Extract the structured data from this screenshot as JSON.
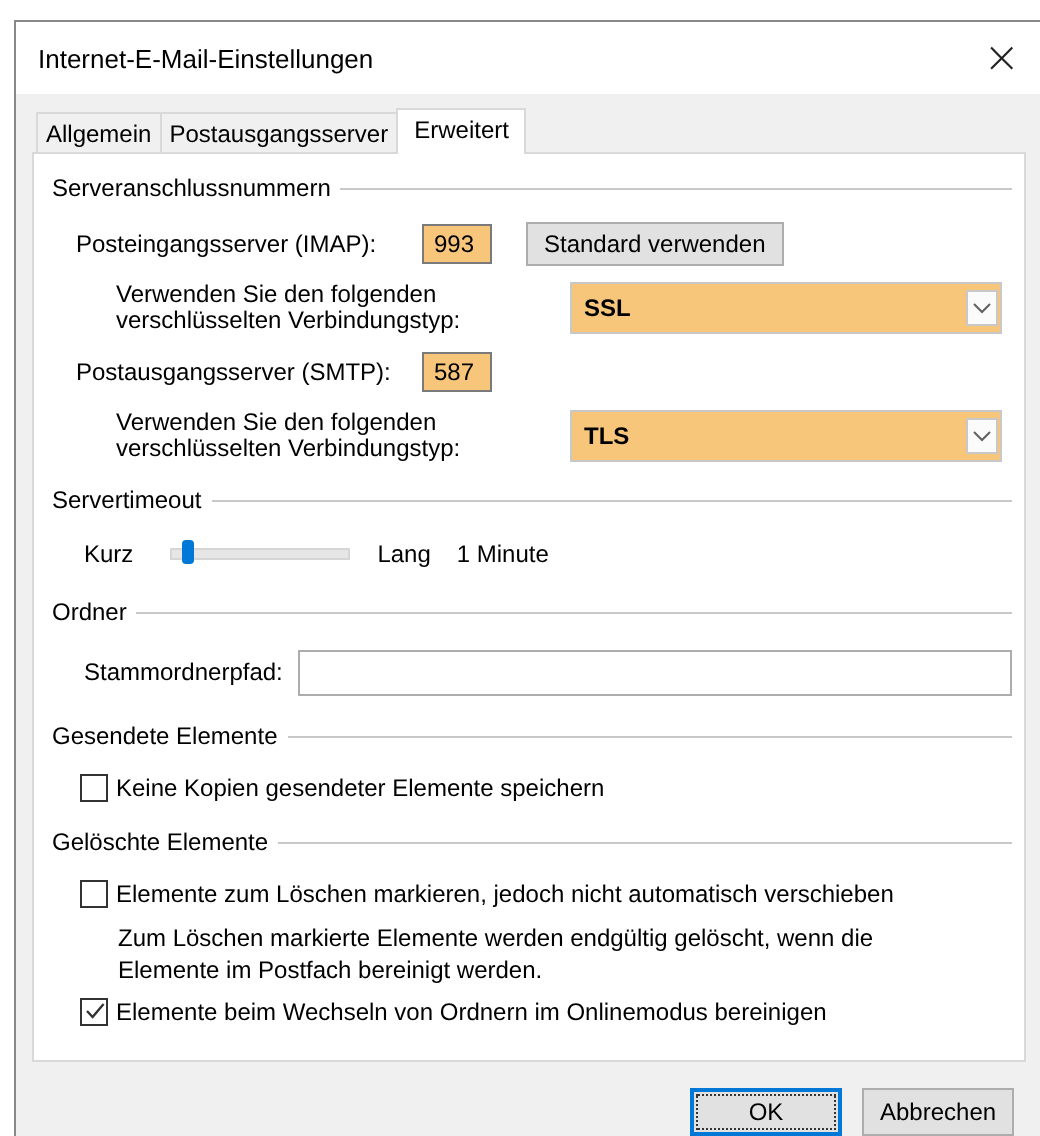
{
  "window": {
    "title": "Internet-E-Mail-Einstellungen",
    "close": "×"
  },
  "tabs": [
    {
      "label": "Allgemein",
      "selected": false
    },
    {
      "label": "Postausgangsserver",
      "selected": false
    },
    {
      "label": "Erweitert",
      "selected": true
    }
  ],
  "sections": [
    {
      "title": "Serveranschlussnummern",
      "items": [
        {
          "kind": "port",
          "label": "Posteingangsserver (IMAP):",
          "value": "993",
          "button": "Standard verwenden"
        },
        {
          "kind": "select",
          "label": "Verwenden Sie den folgenden verschlüsselten Verbindungstyp:",
          "value": "SSL"
        },
        {
          "kind": "port",
          "label": "Postausgangsserver (SMTP):",
          "value": "587"
        },
        {
          "kind": "select",
          "label": "Verwenden Sie den folgenden verschlüsselten Verbindungstyp:",
          "value": "TLS"
        }
      ]
    },
    {
      "title": "Servertimeout",
      "items": [
        {
          "kind": "slider",
          "min_label": "Kurz",
          "max_label": "Lang",
          "reading": "1 Minute",
          "level": 0.1
        }
      ]
    },
    {
      "title": "Ordner",
      "items": [
        {
          "kind": "path",
          "label": "Stammordnerpfad:"
        }
      ]
    },
    {
      "title": "Gesendete Elemente",
      "items": [
        {
          "kind": "checkbox",
          "label": "Keine Kopien gesendeter Elemente speichern",
          "checked": false
        }
      ]
    },
    {
      "title": "Gelöschte Elemente",
      "items": [
        {
          "kind": "checkbox",
          "label": "Elemente zum Löschen markieren, jedoch nicht automatisch verschieben",
          "checked": false
        },
        {
          "kind": "note",
          "text": "Zum Löschen markierte Elemente werden endgültig gelöscht, wenn die Elemente im Postfach bereinigt werden."
        },
        {
          "kind": "checkbox",
          "label": "Elemente beim Wechseln von Ordnern im Onlinemodus bereinigen",
          "checked": true
        }
      ]
    }
  ],
  "buttons": [
    {
      "label": "OK",
      "default": true
    },
    {
      "label": "Abbrechen",
      "default": false
    }
  ]
}
